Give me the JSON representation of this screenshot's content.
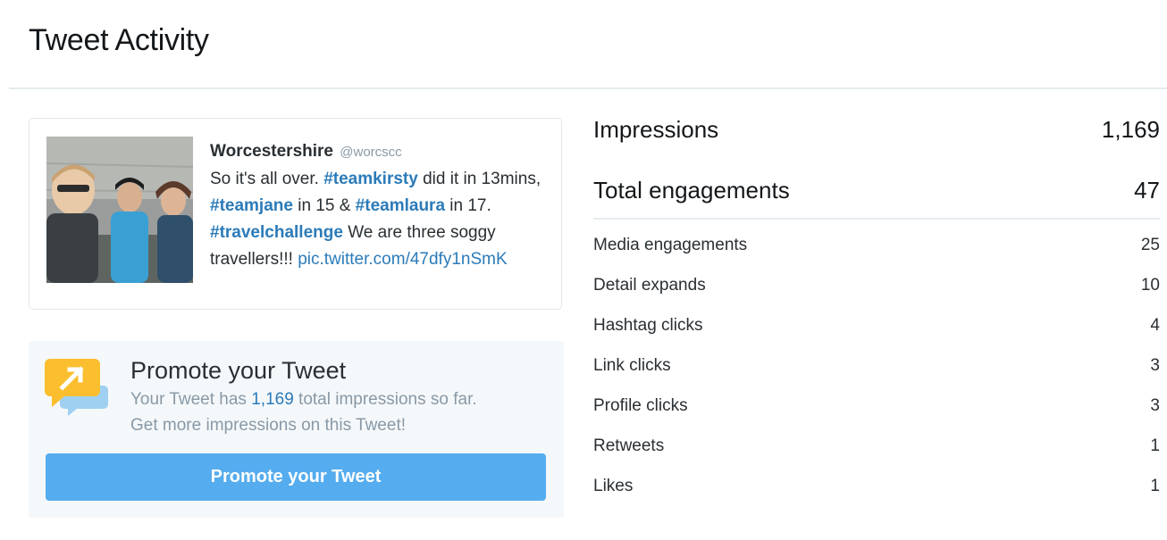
{
  "page": {
    "title": "Tweet Activity"
  },
  "tweet": {
    "author_name": "Worcestershire",
    "author_handle": "@worcscc",
    "text_1": "So it's all over. ",
    "hashtag_1": "#teamkirsty",
    "text_2": " did it in 13mins, ",
    "hashtag_2": "#teamjane",
    "text_3": " in 15 & ",
    "hashtag_3": "#teamlaura",
    "text_4": " in 17. ",
    "hashtag_4": "#travelchallenge",
    "text_5": " We are three soggy travellers!!! ",
    "link": "pic.twitter.com/47dfy1nSmK"
  },
  "promote": {
    "title": "Promote your Tweet",
    "text_before": "Your Tweet has ",
    "impressions": "1,169",
    "text_after": " total impressions so far.",
    "text_line2": "Get more impressions on this Tweet!",
    "button_label": "Promote your Tweet"
  },
  "metrics": {
    "impressions": {
      "label": "Impressions",
      "value": "1,169"
    },
    "total_engagements": {
      "label": "Total engagements",
      "value": "47"
    },
    "breakdown": [
      {
        "label": "Media engagements",
        "value": "25"
      },
      {
        "label": "Detail expands",
        "value": "10"
      },
      {
        "label": "Hashtag clicks",
        "value": "4"
      },
      {
        "label": "Link clicks",
        "value": "3"
      },
      {
        "label": "Profile clicks",
        "value": "3"
      },
      {
        "label": "Retweets",
        "value": "1"
      },
      {
        "label": "Likes",
        "value": "1"
      }
    ]
  },
  "colors": {
    "link": "#2b7bb9",
    "button": "#55acee",
    "promote_bg": "#f5f8fa",
    "icon_yellow": "#fbbe2e",
    "icon_blue": "#9fd0f2"
  },
  "icons": {
    "promote": "promote-megaphone-icon"
  }
}
